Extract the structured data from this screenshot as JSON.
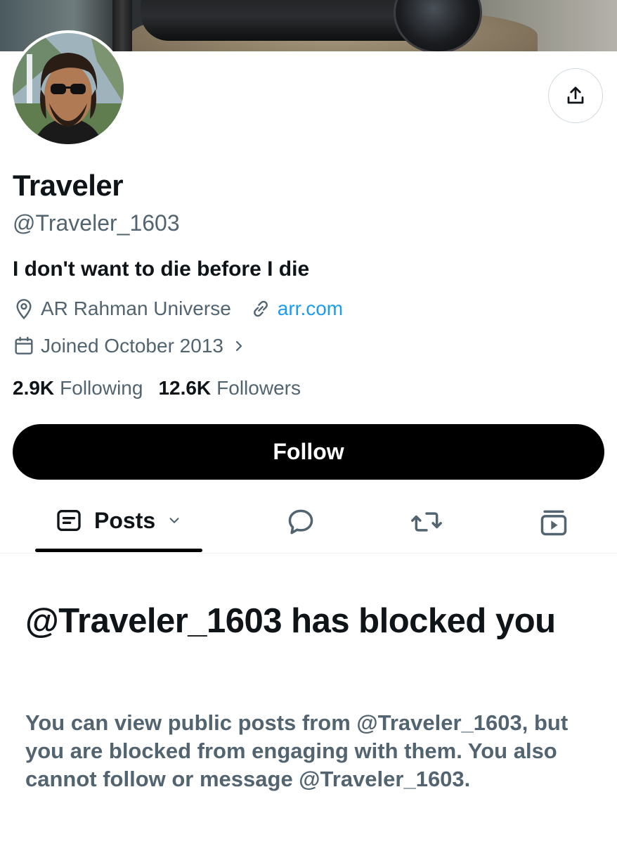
{
  "profile": {
    "display_name": "Traveler",
    "handle": "@Traveler_1603",
    "bio": "I don't want to die before I die",
    "location": "AR Rahman Universe",
    "website": "arr.com",
    "joined": "Joined October 2013"
  },
  "stats": {
    "following_count": "2.9K",
    "following_label": "Following",
    "followers_count": "12.6K",
    "followers_label": "Followers"
  },
  "actions": {
    "follow_label": "Follow"
  },
  "tabs": {
    "posts_label": "Posts",
    "icons": [
      "posts-icon",
      "replies-icon",
      "reposts-icon",
      "media-icon"
    ]
  },
  "blocked": {
    "title": "@Traveler_1603 has blocked you",
    "description": "You can view public posts from @Traveler_1603, but you are blocked from engaging with them. You also cannot follow or message @Traveler_1603."
  },
  "colors": {
    "primary_text": "#0f1419",
    "secondary_text": "#536471",
    "link": "#1d9bf0",
    "follow_button": "#000000"
  }
}
